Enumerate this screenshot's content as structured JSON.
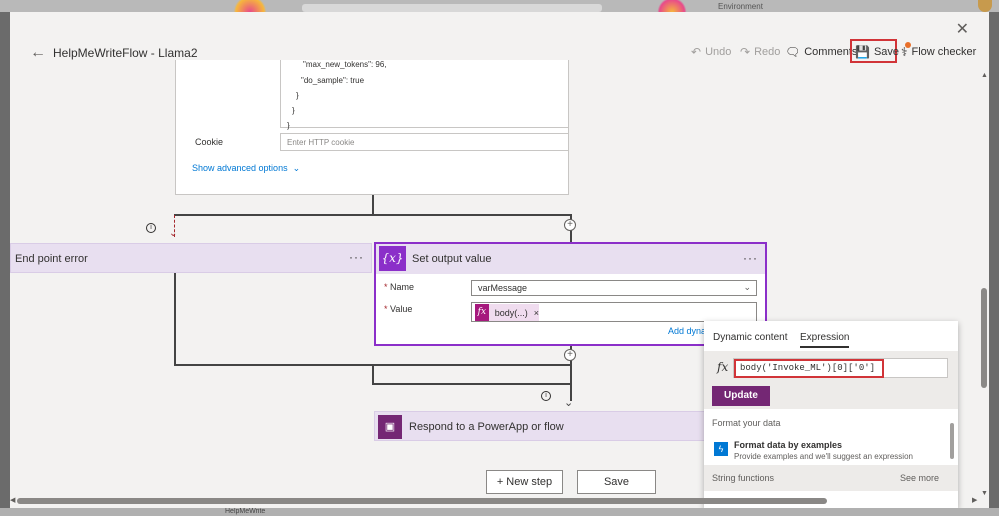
{
  "window": {
    "close_label": "✕"
  },
  "header": {
    "title": "HelpMeWriteFlow - Llama2",
    "undo_label": "Undo",
    "redo_label": "Redo",
    "comments_label": "Comments",
    "save_label": "Save",
    "flow_checker_label": "Flow checker"
  },
  "background": {
    "environment_label": "Environment",
    "bottom_text": "HelpMeWrite"
  },
  "http_card": {
    "json_lines": [
      "\"max_new_tokens\": 96,",
      "\"do_sample\": true",
      "}",
      "}",
      "}"
    ],
    "cookie_label": "Cookie",
    "cookie_placeholder": "Enter HTTP cookie",
    "advanced_label": "Show advanced options"
  },
  "end_point_error": {
    "title": "End point error",
    "menu": "···"
  },
  "set_output": {
    "title": "Set output value",
    "menu": "···",
    "name_label": "Name",
    "name_value": "varMessage",
    "value_label": "Value",
    "token_label": "body(...)",
    "add_dynamic": "Add dyna"
  },
  "respond": {
    "title": "Respond to a PowerApp or flow"
  },
  "buttons": {
    "new_step": "+ New step",
    "save": "Save"
  },
  "expression_panel": {
    "tab_dynamic": "Dynamic content",
    "tab_expression": "Expression",
    "fx_label": "fx",
    "expression_value": "body('Invoke_ML')[0]['0']",
    "update_label": "Update",
    "section_format": "Format your data",
    "format_title": "Format data by examples",
    "format_desc": "Provide examples and we'll suggest an expression",
    "section_string": "String functions",
    "see_more": "See more"
  },
  "colors": {
    "accent": "#742774",
    "action_border": "#8b2fc9",
    "highlight": "#d13438",
    "link": "#0078d4"
  },
  "icons": [
    "back-arrow-icon",
    "undo-icon",
    "redo-icon",
    "comment-icon",
    "save-icon",
    "flow-checker-icon",
    "close-icon",
    "chevron-down-icon",
    "variable-icon",
    "fx-icon",
    "powerapps-icon",
    "info-icon",
    "plus-icon",
    "format-data-icon"
  ]
}
